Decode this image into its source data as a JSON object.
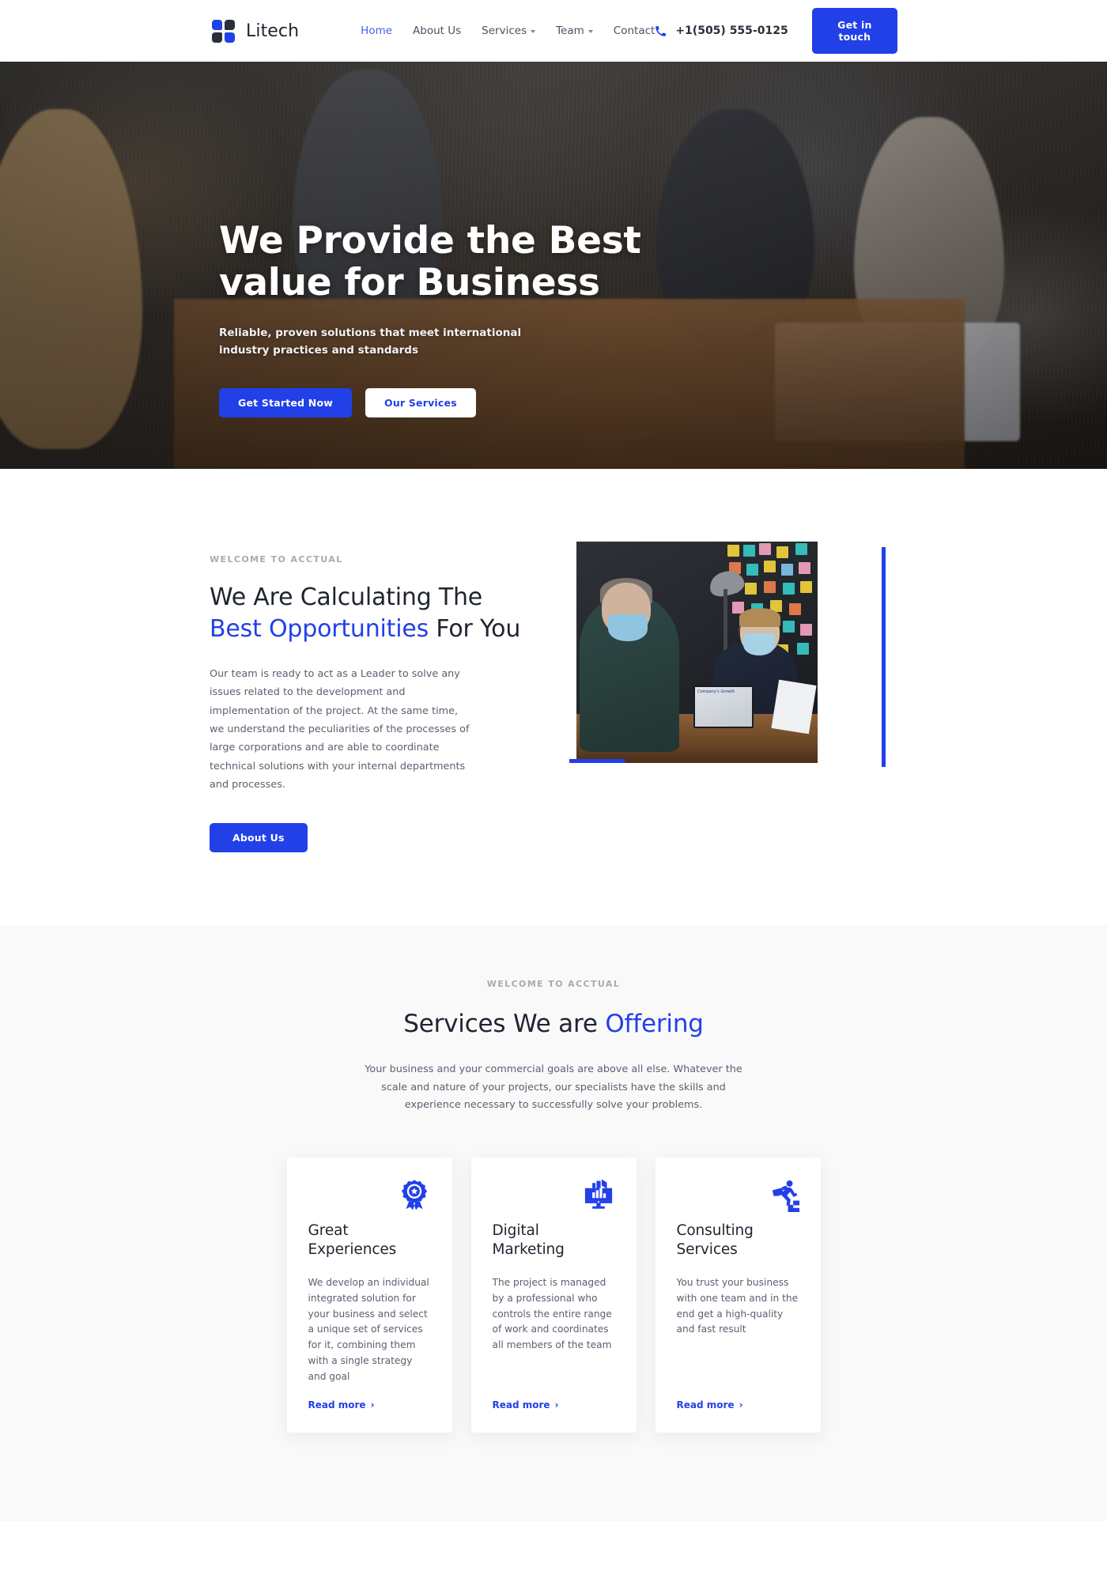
{
  "header": {
    "brand": "Litech",
    "logo_colors": {
      "blue": "#2240e8",
      "dark": "#2b2f3a"
    },
    "nav": [
      {
        "label": "Home",
        "active": true,
        "has_caret": false
      },
      {
        "label": "About Us",
        "active": false,
        "has_caret": false
      },
      {
        "label": "Services",
        "active": false,
        "has_caret": true
      },
      {
        "label": "Team",
        "active": false,
        "has_caret": true
      },
      {
        "label": "Contact",
        "active": false,
        "has_caret": false
      }
    ],
    "phone": "+1(505) 555-0125",
    "cta_label": "Get in touch"
  },
  "hero": {
    "title_line1": "We Provide the Best",
    "title_line2": "value for Business",
    "subtitle": "Reliable, proven solutions that meet international industry practices and standards",
    "primary_button": "Get Started Now",
    "secondary_button": "Our Services"
  },
  "about": {
    "eyebrow": "WELCOME TO ACCTUAL",
    "heading_line1": "We Are Calculating The",
    "heading_accent": "Best Opportunities",
    "heading_tail": " For You",
    "paragraph": "Our team is ready to act as a Leader to solve any issues related to the development and implementation of the project. At the same time, we understand the peculiarities of the processes of large corporations and are able to coordinate technical solutions with your internal departments and processes.",
    "button": "About Us",
    "image_caption": "Company's Growth"
  },
  "services": {
    "eyebrow": "WELCOME TO ACCTUAL",
    "heading": "Services We are ",
    "heading_accent": "Offering",
    "paragraph": "Your business and your commercial goals are above all else. Whatever the scale and nature of your projects, our specialists have the skills and experience necessary to successfully solve your problems.",
    "cards": [
      {
        "icon": "award-badge-icon",
        "title": "Great Experiences",
        "text": "We develop an individual integrated solution for your business and select a unique set of services for it, combining them with a single strategy and goal",
        "link": "Read more"
      },
      {
        "icon": "monitor-megaphone-icon",
        "title": "Digital Marketing",
        "text": "The project is managed by a professional who controls the entire range of work and coordinates all members of the team",
        "link": "Read more"
      },
      {
        "icon": "businessman-stairs-icon",
        "title": "Consulting Services",
        "text": "You trust your business with one team and in the end get a high-quality and fast result",
        "link": "Read more"
      }
    ]
  },
  "theme": {
    "accent_blue": "#2240e8",
    "nav_active_blue": "#4a62e8",
    "text_dark": "#1f2430",
    "text_muted": "#5a6070",
    "eyebrow_gray": "#a8aab2",
    "section_bg": "#f9f9fa"
  }
}
